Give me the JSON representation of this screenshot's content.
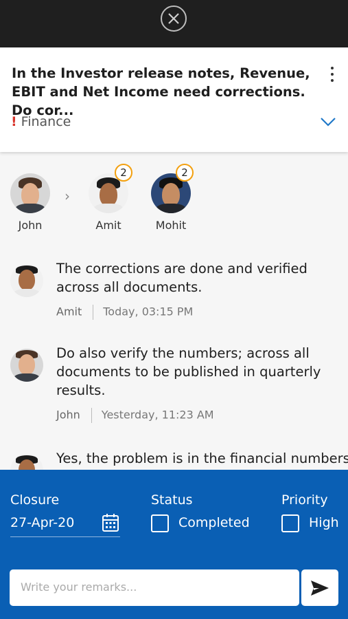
{
  "header": {
    "close_icon": "close-icon"
  },
  "task": {
    "title": "In the Investor release notes, Revenue, EBIT and Net Income need corrections. Do cor...",
    "category": "Finance",
    "priority_marker": "!",
    "colors": {
      "marker": "#d9342b",
      "accent": "#0a5fb4",
      "badge": "#f3a00f"
    }
  },
  "people": [
    {
      "name": "John",
      "badge": ""
    },
    {
      "name": "Amit",
      "badge": "2"
    },
    {
      "name": "Mohit",
      "badge": "2"
    }
  ],
  "messages": [
    {
      "text": "The corrections are done and verified across all documents.",
      "author": "Amit",
      "time": "Today, 03:15 PM"
    },
    {
      "text": "Do also verify the numbers; across all documents to be published in quarterly results.",
      "author": "John",
      "time": "Yesterday, 11:23 AM"
    },
    {
      "text": "Yes, the problem is in the financial numbers"
    }
  ],
  "footer": {
    "closure_label": "Closure",
    "closure_date": "27-Apr-20",
    "status_label": "Status",
    "status_option": "Completed",
    "priority_label": "Priority",
    "priority_option": "High",
    "remarks_placeholder": "Write your remarks...",
    "send_icon": "send-icon"
  }
}
